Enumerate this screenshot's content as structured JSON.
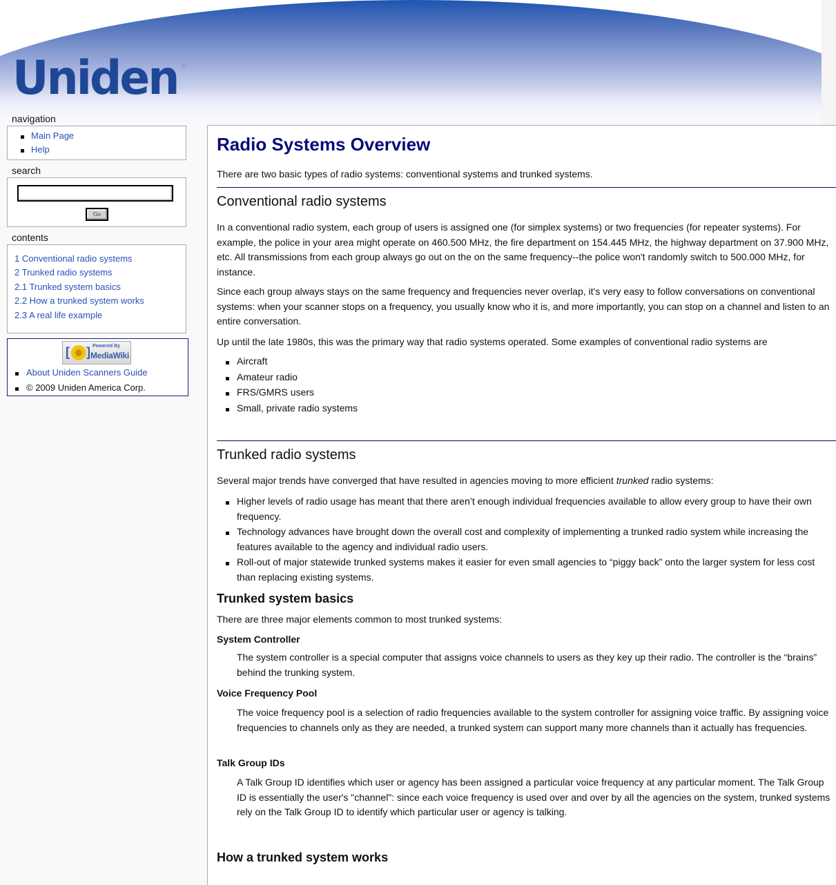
{
  "header": {
    "logo_text": "Uniden",
    "logo_mark": "®"
  },
  "sidebar": {
    "navigation": {
      "title": "navigation",
      "items": [
        {
          "label": "Main Page"
        },
        {
          "label": "Help"
        }
      ]
    },
    "search": {
      "title": "search",
      "input_value": "",
      "go_label": "Go"
    },
    "contents": {
      "title": "contents",
      "items": [
        {
          "label": "1 Conventional radio systems"
        },
        {
          "label": "2 Trunked radio systems"
        },
        {
          "label": "2.1 Trunked system basics"
        },
        {
          "label": "2.2 How a trunked system works"
        },
        {
          "label": "2.3 A real life example"
        }
      ]
    },
    "footer": {
      "badge_powered": "Powered By",
      "badge_name": "MediaWiki",
      "items": [
        {
          "label": "About Uniden Scanners Guide"
        },
        {
          "label": "© 2009 Uniden America Corp."
        }
      ]
    }
  },
  "article": {
    "title": "Radio Systems Overview",
    "intro": "There are two basic types of radio systems: conventional systems and trunked systems.",
    "conventional": {
      "heading": "Conventional radio systems",
      "p1": "In a conventional radio system, each group of users is assigned one (for simplex systems) or two frequencies (for repeater systems). For example, the police in your area might operate on 460.500 MHz, the fire department on 154.445 MHz, the highway department on 37.900 MHz, etc. All transmissions from each group always go out on the on the same frequency--the police won't randomly switch to 500.000 MHz, for instance.",
      "p2": "Since each group always stays on the same frequency and frequencies never overlap, it's very easy to follow conversations on conventional systems: when your scanner stops on a frequency, you usually know who it is, and more importantly, you can stop on a channel and listen to an entire conversation.",
      "p3": "Up until the late 1980s, this was the primary way that radio systems operated. Some examples of conventional radio systems are",
      "examples": [
        "Aircraft",
        "Amateur radio",
        "FRS/GMRS users",
        "Small, private radio systems"
      ]
    },
    "trunked": {
      "heading": "Trunked radio systems",
      "intro_before": "Several major trends have converged that have resulted in agencies moving to more efficient ",
      "intro_em": "trunked",
      "intro_after": " radio systems:",
      "trends": [
        "Higher levels of radio usage has meant that there aren’t enough individual frequencies available to allow every group to have their own frequency.",
        "Technology advances have brought down the overall cost and complexity of implementing a trunked radio system while increasing the features available to the agency and individual radio users.",
        "Roll-out of major statewide trunked systems makes it easier for even small agencies to “piggy back” onto the larger system for less cost than replacing existing systems."
      ]
    },
    "basics": {
      "heading": "Trunked system basics",
      "intro": "There are three major elements common to most trunked systems:",
      "terms": [
        {
          "term": "System Controller",
          "definition": "The system controller is a special computer that assigns voice channels to users as they key up their radio. The controller is the “brains” behind the trunking system."
        },
        {
          "term": "Voice Frequency Pool",
          "definition": "The voice frequency pool is a selection of radio frequencies available to the system controller for assigning voice traffic. By assigning voice frequencies to channels only as they are needed, a trunked system can support many more channels than it actually has frequencies."
        },
        {
          "term": "Talk Group IDs",
          "definition": "A Talk Group ID identifies which user or agency has been assigned a particular voice frequency at any particular moment. The Talk Group ID is essentially the user's \"channel\": since each voice frequency is used over and over by all the agencies on the system, trunked systems rely on the Talk Group ID to identify which particular user or agency is talking."
        }
      ]
    },
    "how_it_works": {
      "heading": "How a trunked system works"
    }
  },
  "colors": {
    "link": "#2a4fb5",
    "title": "#0a0a7a",
    "logo": "#1f4797",
    "sidebar_bg": "#f9f9f9"
  }
}
